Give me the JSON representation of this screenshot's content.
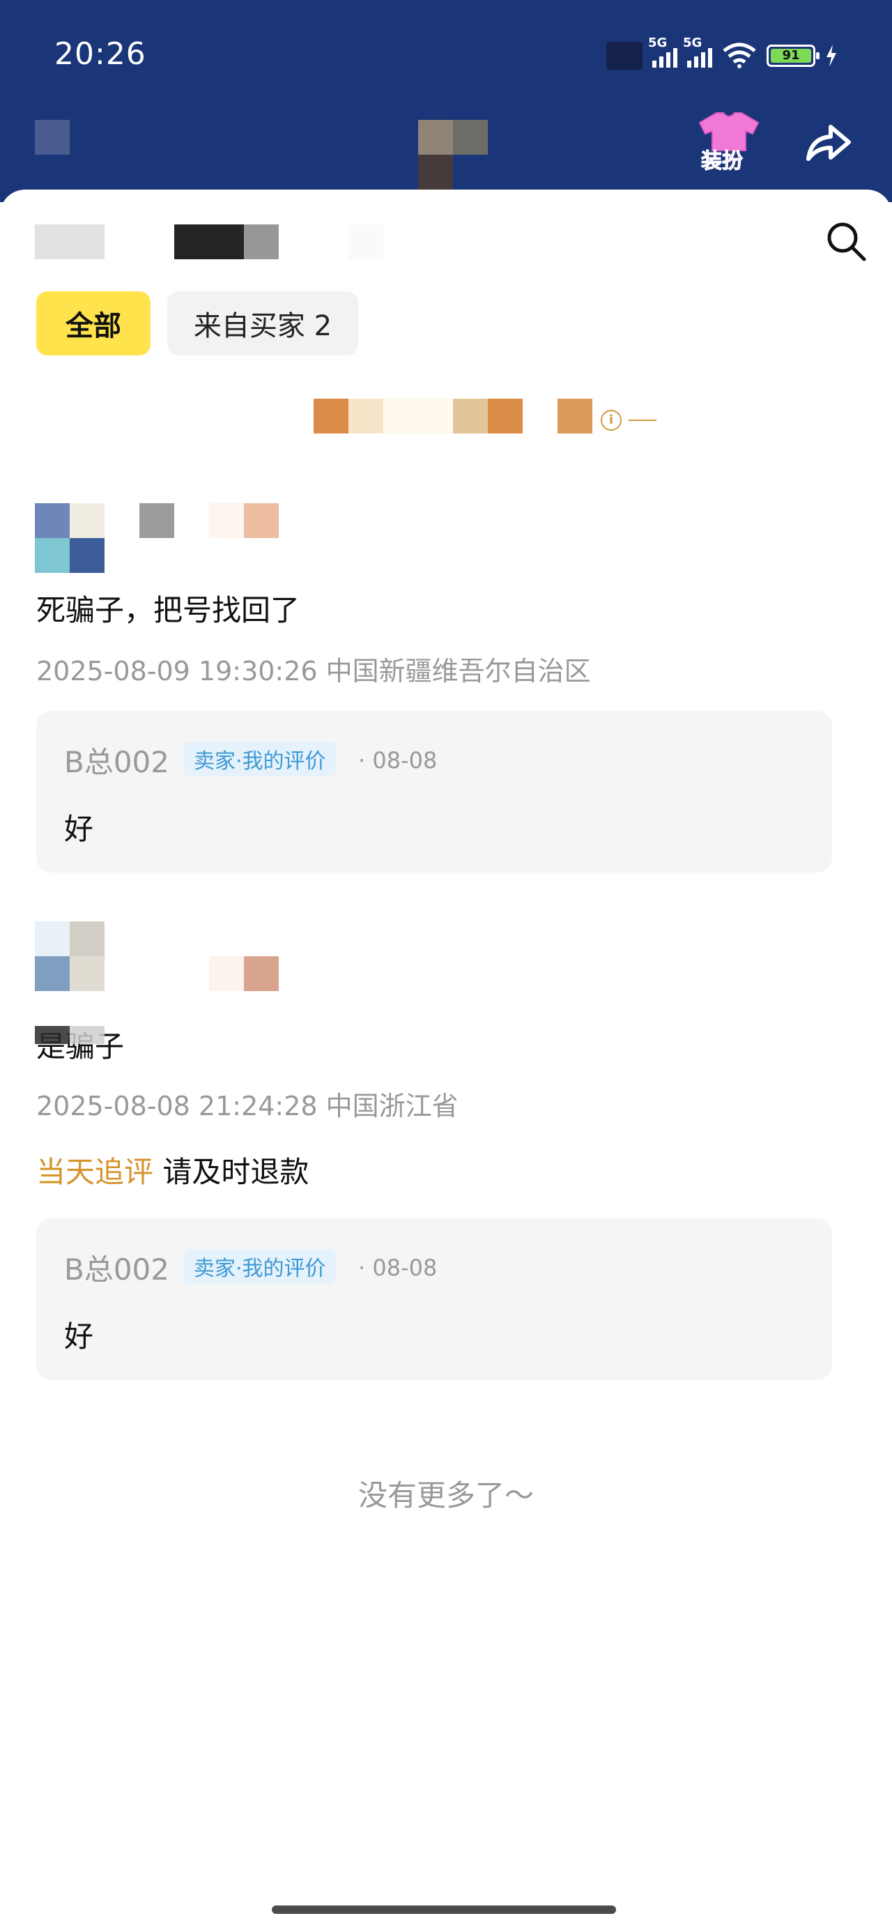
{
  "status_bar": {
    "time": "20:26",
    "network1": "5G",
    "network2": "5G",
    "battery": "91"
  },
  "header": {
    "costume_label": "装扮",
    "share_icon": "share-icon"
  },
  "filters": {
    "all": "全部",
    "from_buyer": "来自买家 2"
  },
  "reviews": [
    {
      "text": "死骗子，把号找回了",
      "meta": "2025-08-09 19:30:26 中国新疆维吾尔自治区",
      "reply": {
        "name": "B总002",
        "tag": "卖家·我的评价",
        "date": "· 08-08",
        "text": "好"
      }
    },
    {
      "text": "是骗子",
      "meta": "2025-08-08 21:24:28 中国浙江省",
      "followup_label": "当天追评",
      "followup_text": "请及时退款",
      "reply": {
        "name": "B总002",
        "tag": "卖家·我的评价",
        "date": "· 08-08",
        "text": "好"
      }
    }
  ],
  "footer": {
    "no_more": "没有更多了～"
  },
  "colors": {
    "header_bg": "#1b3579",
    "tab_active": "#ffe34d",
    "followup": "#d4952c",
    "seller_tag": "#3c9ad6"
  }
}
